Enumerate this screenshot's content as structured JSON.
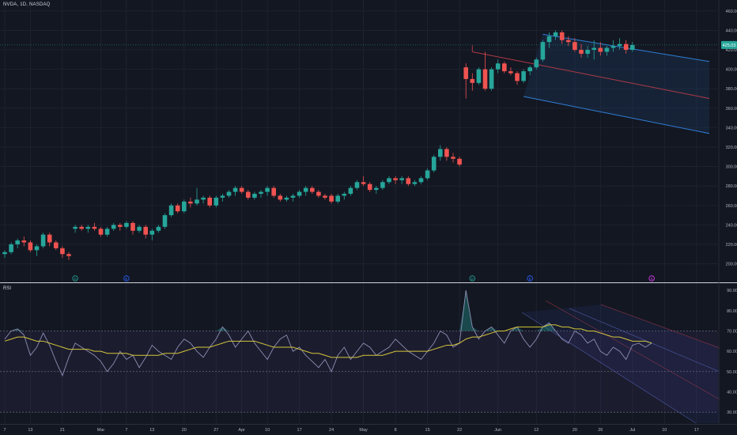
{
  "header": {
    "symbol": "NVDA, 1D, NASDAQ",
    "rsi_label": "RSI"
  },
  "colors": {
    "bg": "#131722",
    "up": "#26a69a",
    "down": "#ef5350",
    "grid": "#1f2432",
    "rsi_line": "#8d8fb3",
    "rsi_ma": "#d4c63a",
    "channel_blue": "#2f7fd6",
    "channel_red": "#b03a45"
  },
  "chart_data": [
    {
      "type": "candlestick",
      "title": "",
      "price_axis_ticks": [
        200,
        220,
        240,
        260,
        280,
        300,
        320,
        340,
        360,
        380,
        400,
        420,
        440,
        460
      ],
      "ylim": [
        185,
        468
      ],
      "last_price": "425.03",
      "last_price_value": 425,
      "x_tick_labels": [
        {
          "label": "7",
          "index": 0
        },
        {
          "label": "13",
          "index": 4
        },
        {
          "label": "21",
          "index": 9
        },
        {
          "label": "Mar",
          "index": 15
        },
        {
          "label": "7",
          "index": 19
        },
        {
          "label": "13",
          "index": 23
        },
        {
          "label": "20",
          "index": 28
        },
        {
          "label": "27",
          "index": 33
        },
        {
          "label": "Apr",
          "index": 37
        },
        {
          "label": "10",
          "index": 41
        },
        {
          "label": "17",
          "index": 46
        },
        {
          "label": "24",
          "index": 51
        },
        {
          "label": "May",
          "index": 56
        },
        {
          "label": "8",
          "index": 61
        },
        {
          "label": "15",
          "index": 66
        },
        {
          "label": "22",
          "index": 71
        },
        {
          "label": "Jun",
          "index": 77
        },
        {
          "label": "12",
          "index": 83
        },
        {
          "label": "20",
          "index": 89
        },
        {
          "label": "26",
          "index": 93
        },
        {
          "label": "Jul",
          "index": 98
        },
        {
          "label": "10",
          "index": 103
        },
        {
          "label": "17",
          "index": 108
        }
      ],
      "total_slots": 112,
      "candles": [
        [
          210,
          214,
          206,
          212
        ],
        [
          212,
          222,
          210,
          220
        ],
        [
          220,
          226,
          216,
          224
        ],
        [
          224,
          228,
          218,
          222
        ],
        [
          222,
          224,
          212,
          214
        ],
        [
          214,
          220,
          208,
          218
        ],
        [
          218,
          232,
          216,
          230
        ],
        [
          230,
          232,
          218,
          222
        ],
        [
          222,
          224,
          214,
          216
        ],
        [
          216,
          218,
          206,
          210
        ],
        [
          210,
          212,
          204,
          208
        ],
        [
          236,
          240,
          232,
          238
        ],
        [
          238,
          240,
          234,
          236
        ],
        [
          236,
          240,
          232,
          238
        ],
        [
          238,
          242,
          234,
          236
        ],
        [
          236,
          238,
          228,
          230
        ],
        [
          230,
          238,
          228,
          236
        ],
        [
          236,
          242,
          234,
          240
        ],
        [
          240,
          242,
          234,
          238
        ],
        [
          238,
          244,
          236,
          242
        ],
        [
          242,
          244,
          230,
          234
        ],
        [
          234,
          240,
          232,
          238
        ],
        [
          238,
          240,
          226,
          230
        ],
        [
          230,
          236,
          224,
          234
        ],
        [
          234,
          240,
          232,
          238
        ],
        [
          238,
          252,
          236,
          250
        ],
        [
          250,
          262,
          248,
          260
        ],
        [
          260,
          262,
          252,
          254
        ],
        [
          254,
          266,
          252,
          264
        ],
        [
          264,
          268,
          258,
          262
        ],
        [
          262,
          278,
          260,
          266
        ],
        [
          266,
          270,
          262,
          268
        ],
        [
          268,
          270,
          258,
          260
        ],
        [
          260,
          270,
          258,
          268
        ],
        [
          268,
          272,
          264,
          270
        ],
        [
          270,
          276,
          268,
          274
        ],
        [
          274,
          280,
          270,
          278
        ],
        [
          278,
          280,
          272,
          274
        ],
        [
          274,
          276,
          266,
          268
        ],
        [
          268,
          274,
          266,
          272
        ],
        [
          272,
          276,
          268,
          274
        ],
        [
          274,
          280,
          270,
          278
        ],
        [
          278,
          280,
          268,
          270
        ],
        [
          270,
          272,
          264,
          266
        ],
        [
          266,
          270,
          264,
          268
        ],
        [
          268,
          272,
          264,
          270
        ],
        [
          270,
          276,
          268,
          274
        ],
        [
          274,
          280,
          270,
          278
        ],
        [
          278,
          280,
          272,
          274
        ],
        [
          274,
          276,
          268,
          270
        ],
        [
          270,
          272,
          266,
          268
        ],
        [
          270,
          272,
          262,
          264
        ],
        [
          264,
          272,
          262,
          270
        ],
        [
          270,
          274,
          266,
          272
        ],
        [
          272,
          280,
          270,
          278
        ],
        [
          278,
          286,
          276,
          284
        ],
        [
          284,
          290,
          280,
          282
        ],
        [
          282,
          284,
          274,
          276
        ],
        [
          276,
          280,
          272,
          278
        ],
        [
          278,
          286,
          276,
          284
        ],
        [
          284,
          290,
          282,
          288
        ],
        [
          288,
          290,
          282,
          286
        ],
        [
          286,
          290,
          282,
          288
        ],
        [
          288,
          290,
          280,
          282
        ],
        [
          282,
          286,
          280,
          284
        ],
        [
          284,
          290,
          282,
          288
        ],
        [
          288,
          298,
          286,
          296
        ],
        [
          296,
          312,
          294,
          310
        ],
        [
          310,
          322,
          306,
          318
        ],
        [
          318,
          320,
          306,
          310
        ],
        [
          310,
          314,
          304,
          308
        ],
        [
          308,
          310,
          300,
          302
        ],
        [
          402,
          406,
          370,
          390
        ],
        [
          390,
          396,
          378,
          386
        ],
        [
          386,
          402,
          384,
          400
        ],
        [
          400,
          418,
          378,
          380
        ],
        [
          380,
          402,
          378,
          400
        ],
        [
          400,
          410,
          396,
          406
        ],
        [
          406,
          408,
          396,
          398
        ],
        [
          398,
          402,
          394,
          396
        ],
        [
          396,
          398,
          384,
          388
        ],
        [
          388,
          400,
          386,
          398
        ],
        [
          398,
          404,
          394,
          402
        ],
        [
          402,
          412,
          400,
          410
        ],
        [
          410,
          430,
          408,
          428
        ],
        [
          428,
          438,
          422,
          434
        ],
        [
          434,
          440,
          430,
          438
        ],
        [
          438,
          440,
          426,
          430
        ],
        [
          430,
          434,
          424,
          428
        ],
        [
          428,
          432,
          418,
          420
        ],
        [
          420,
          426,
          412,
          416
        ],
        [
          416,
          424,
          412,
          420
        ],
        [
          420,
          430,
          410,
          422
        ],
        [
          422,
          428,
          414,
          418
        ],
        [
          418,
          424,
          414,
          422
        ],
        [
          422,
          430,
          418,
          424
        ],
        [
          424,
          432,
          420,
          426
        ],
        [
          426,
          430,
          416,
          420
        ],
        [
          420,
          428,
          418,
          425
        ]
      ],
      "regression_channel": {
        "upper": {
          "from": [
            84,
            436
          ],
          "to": [
            110,
            408
          ]
        },
        "middle": {
          "from": [
            73,
            418
          ],
          "to": [
            110,
            370
          ]
        },
        "lower": {
          "from": [
            81,
            372
          ],
          "to": [
            110,
            334
          ]
        }
      },
      "event_markers": [
        {
          "index": 11,
          "label": "D"
        },
        {
          "index": 19,
          "label": "E"
        },
        {
          "index": 73,
          "label": "D"
        },
        {
          "index": 82,
          "label": "E"
        },
        {
          "index": 101,
          "label": "S"
        }
      ]
    },
    {
      "type": "line",
      "title": "RSI",
      "ylim": [
        25,
        92
      ],
      "ticks": [
        30,
        40,
        50,
        60,
        70,
        80,
        90
      ],
      "overbought": 70,
      "oversold": 30,
      "midline": 50,
      "series": [
        {
          "values": [
            66,
            70,
            71,
            68,
            58,
            62,
            69,
            63,
            55,
            48,
            57,
            64,
            62,
            60,
            58,
            55,
            50,
            54,
            60,
            56,
            58,
            52,
            57,
            63,
            60,
            58,
            56,
            62,
            66,
            64,
            60,
            57,
            62,
            66,
            72,
            68,
            62,
            66,
            70,
            64,
            60,
            56,
            62,
            66,
            68,
            60,
            62,
            58,
            55,
            52,
            56,
            50,
            58,
            62,
            56,
            60,
            64,
            62,
            58,
            60,
            62,
            66,
            63,
            60,
            58,
            56,
            60,
            64,
            70,
            68,
            62,
            64,
            90,
            72,
            66,
            70,
            72,
            68,
            64,
            70,
            72,
            66,
            62,
            66,
            72,
            74,
            70,
            66,
            64,
            70,
            68,
            64,
            66,
            60,
            58,
            62,
            60,
            56,
            63,
            64,
            62,
            64
          ]
        },
        {
          "values": [
            65,
            66,
            67,
            67,
            66,
            65,
            65,
            64,
            63,
            62,
            61,
            61,
            61,
            61,
            60,
            60,
            59,
            59,
            59,
            59,
            58,
            58,
            58,
            58,
            58,
            59,
            59,
            59,
            60,
            61,
            62,
            62,
            62,
            63,
            64,
            65,
            65,
            65,
            65,
            65,
            64,
            63,
            62,
            62,
            62,
            62,
            61,
            60,
            59,
            59,
            58,
            57,
            57,
            57,
            57,
            57,
            58,
            58,
            58,
            58,
            59,
            60,
            60,
            60,
            60,
            60,
            60,
            61,
            62,
            63,
            63,
            64,
            66,
            67,
            67,
            68,
            69,
            70,
            70,
            71,
            72,
            72,
            72,
            72,
            72,
            73,
            73,
            72,
            72,
            71,
            71,
            70,
            70,
            69,
            68,
            67,
            67,
            66,
            65,
            65,
            65,
            64
          ]
        }
      ]
    }
  ]
}
